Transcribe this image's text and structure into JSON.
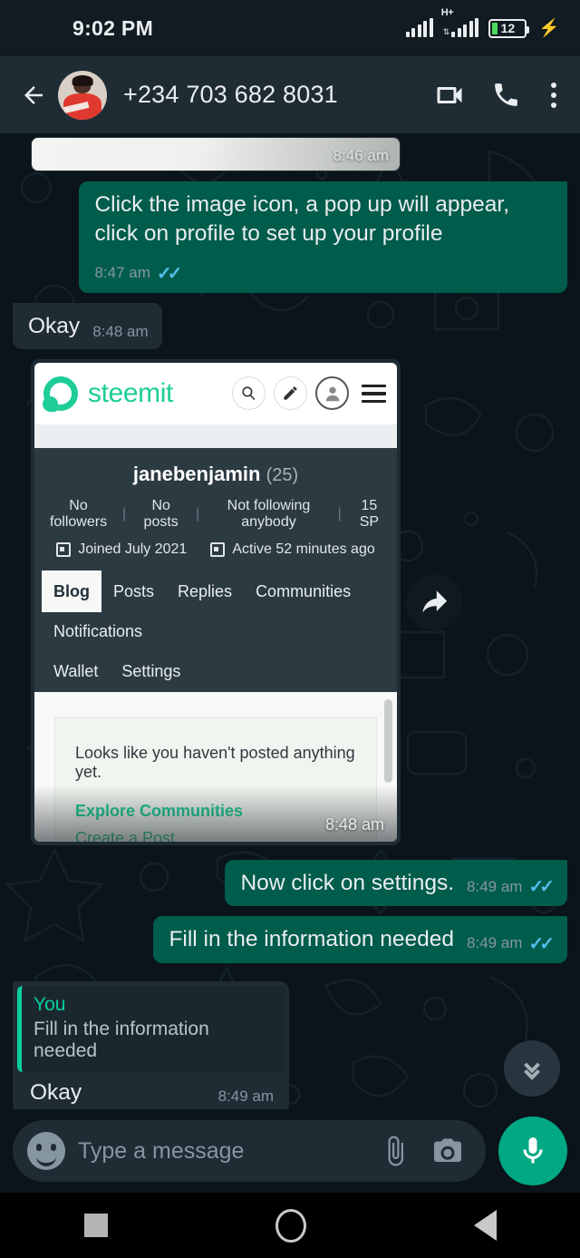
{
  "status_bar": {
    "time": "9:02 PM",
    "network_type": "H+",
    "battery_percent": "12",
    "icons": [
      "signal-icon",
      "data-signal-icon",
      "battery-icon",
      "charging-bolt-icon"
    ]
  },
  "app_bar": {
    "back_icon": "back-arrow-icon",
    "contact_name": "+234 703 682 8031",
    "video_call_icon": "video-call-icon",
    "voice_call_icon": "phone-call-icon",
    "overflow_icon": "more-options-icon"
  },
  "messages": [
    {
      "type": "image",
      "direction": "in",
      "time": "8:46 am",
      "partial": true
    },
    {
      "type": "text",
      "direction": "out",
      "text": "Click the image icon, a pop up will appear, click on profile to set up your profile",
      "time": "8:47 am",
      "status": "read"
    },
    {
      "type": "text",
      "direction": "in",
      "text": "Okay",
      "time": "8:48 am"
    },
    {
      "type": "image",
      "direction": "in",
      "time": "8:48 am",
      "caption": "steemit-profile-screenshot"
    },
    {
      "type": "text",
      "direction": "out",
      "text": "Now click on settings.",
      "time": "8:49 am",
      "status": "read"
    },
    {
      "type": "text",
      "direction": "out",
      "text": "Fill in the information needed",
      "time": "8:49 am",
      "status": "read"
    },
    {
      "type": "reply",
      "direction": "in",
      "quote_author": "You",
      "quote_text": "Fill in the information needed",
      "text": "Okay",
      "time": "8:49 am"
    },
    {
      "type": "image",
      "direction": "in",
      "partial": true
    }
  ],
  "steemit_card": {
    "brand": "steemit",
    "header_icons": [
      "search-icon",
      "pencil-icon",
      "user-avatar-icon",
      "hamburger-menu-icon"
    ],
    "username": "janebenjamin",
    "reputation": "(25)",
    "stats": [
      "No followers",
      "No posts",
      "Not following anybody",
      "15 SP"
    ],
    "joined": "Joined July 2021",
    "active": "Active 52 minutes ago",
    "tabs_primary": [
      "Blog",
      "Posts",
      "Replies",
      "Communities"
    ],
    "active_tab": "Blog",
    "tabs_secondary": [
      "Notifications"
    ],
    "tabs_tertiary": [
      "Wallet",
      "Settings"
    ],
    "empty_state_text": "Looks like you haven't posted anything yet.",
    "empty_links": [
      "Explore Communities",
      "Create a Post"
    ]
  },
  "forward_button": {
    "icon": "forward-arrow-icon"
  },
  "scroll_down_button": {
    "icon": "double-chevron-down-icon"
  },
  "input_bar": {
    "emoji_icon": "emoji-icon",
    "placeholder": "Type a message",
    "value": "",
    "attach_icon": "paperclip-icon",
    "camera_icon": "camera-icon",
    "mic_icon": "microphone-icon"
  },
  "nav_bar": {
    "recents_icon": "recents-square-icon",
    "home_icon": "home-circle-icon",
    "back_icon": "back-triangle-icon"
  },
  "colors": {
    "chat_background": "#0b141a",
    "outgoing_bubble": "#005c4b",
    "incoming_bubble": "#1f2c34",
    "app_bar": "#1f2c34",
    "status_bar": "#111b21",
    "accent_green": "#00a884",
    "tick_blue": "#53bdeb",
    "steemit_green": "#1ecd97"
  }
}
